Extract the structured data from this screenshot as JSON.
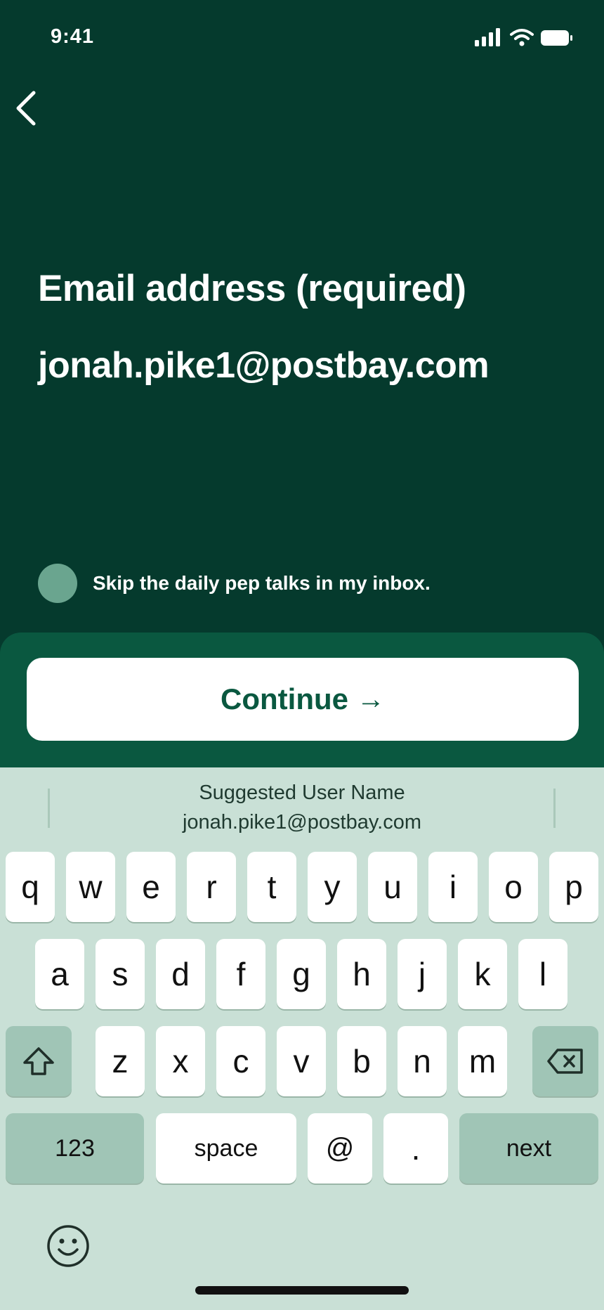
{
  "status_bar": {
    "time": "9:41"
  },
  "nav": {
    "back_icon": "chevron-left-icon"
  },
  "form": {
    "title": "Email address (required)",
    "email_value": "jonah.pike1@postbay.com",
    "opt_out_label": "Skip the daily pep talks in my inbox."
  },
  "cta": {
    "continue_label": "Continue",
    "continue_arrow": "→"
  },
  "suggestion": {
    "title": "Suggested User Name",
    "value": "jonah.pike1@postbay.com"
  },
  "keyboard": {
    "row1": [
      "q",
      "w",
      "e",
      "r",
      "t",
      "y",
      "u",
      "i",
      "o",
      "p"
    ],
    "row2": [
      "a",
      "s",
      "d",
      "f",
      "g",
      "h",
      "j",
      "k",
      "l"
    ],
    "row3": [
      "z",
      "x",
      "c",
      "v",
      "b",
      "n",
      "m"
    ],
    "numbers_label": "123",
    "space_label": "space",
    "at_label": "@",
    "dot_label": ".",
    "next_label": "next"
  },
  "colors": {
    "background": "#053a2d",
    "cta_bar": "#0a5840",
    "keyboard_bg": "#c9e0d6",
    "radio": "#6aa58f"
  }
}
